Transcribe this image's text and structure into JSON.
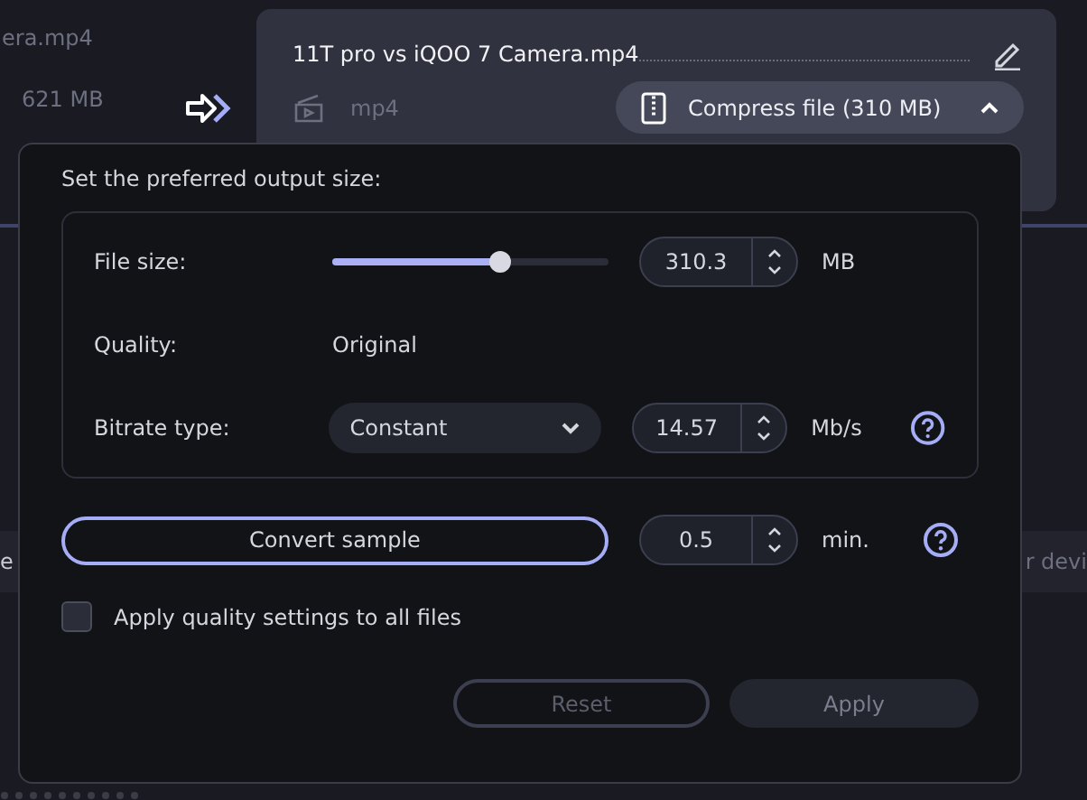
{
  "background": {
    "left_file_name": "era.mp4",
    "left_file_size": "621 MB",
    "left_band_text": "e",
    "right_band_text": "r devi"
  },
  "file_card": {
    "name": "11T pro vs iQOO 7 Camera.mp4",
    "format": "mp4",
    "compress_button": {
      "label": "Compress file (310 MB)",
      "expanded": true
    }
  },
  "popup": {
    "title": "Set the preferred output size:",
    "file_size": {
      "label": "File size:",
      "level": 0.61,
      "value": "310.3",
      "unit": "MB"
    },
    "quality": {
      "label": "Quality:",
      "value": "Original"
    },
    "bitrate": {
      "label": "Bitrate type:",
      "type": "Constant",
      "value": "14.57",
      "unit": "Mb/s"
    },
    "sample": {
      "button": "Convert sample",
      "value": "0.5",
      "unit": "min."
    },
    "apply_all": {
      "label": "Apply quality settings to all files",
      "checked": false
    },
    "buttons": [
      {
        "kind": "outline",
        "label": "Reset",
        "disabled": true
      },
      {
        "kind": "filled",
        "label": "Apply",
        "disabled": true
      }
    ]
  }
}
